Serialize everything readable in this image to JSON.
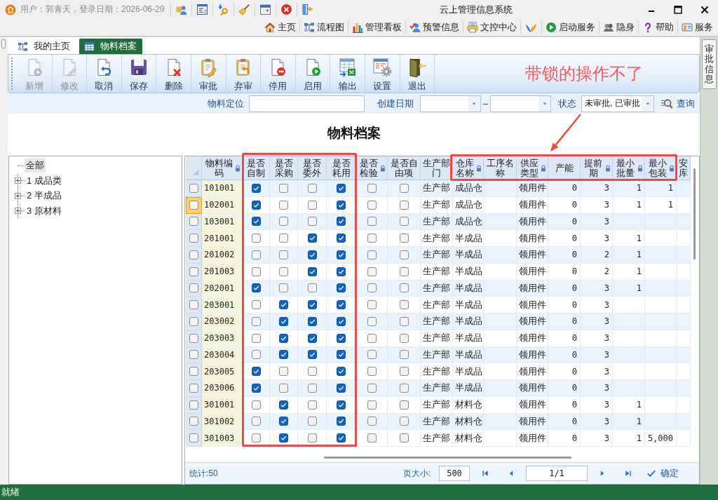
{
  "title_bar": {
    "user_info": "用户：郭青天，登录日期：2026-06-29",
    "title": "云上管理信息系统"
  },
  "quick_links": [
    {
      "label": "主页",
      "kind": "home"
    },
    {
      "label": "流程图",
      "kind": "flow"
    },
    {
      "label": "管理看板",
      "kind": "chart"
    },
    {
      "label": "预警信息",
      "kind": "alert"
    },
    {
      "label": "文控中心",
      "kind": "document"
    },
    {
      "kind": "logo"
    },
    {
      "label": "启动服务",
      "kind": "start"
    },
    {
      "label": "隐身",
      "kind": "hide"
    },
    {
      "label": "帮助",
      "kind": "help"
    },
    {
      "label": "服务",
      "kind": "service"
    }
  ],
  "tabs": [
    {
      "label": "我的主页",
      "kind": "home",
      "selected": false
    },
    {
      "label": "物料档案",
      "kind": "grid",
      "selected": true
    }
  ],
  "toolbar": [
    {
      "label": "新增",
      "kind": "new",
      "disabled": true
    },
    {
      "label": "修改",
      "kind": "edit",
      "disabled": true
    },
    {
      "label": "取消",
      "kind": "cancel",
      "disabled": false
    },
    {
      "label": "保存",
      "kind": "save",
      "disabled": false
    },
    {
      "label": "删除",
      "kind": "delete",
      "disabled": false
    },
    {
      "label": "审批",
      "kind": "approve",
      "disabled": false
    },
    {
      "label": "弃审",
      "kind": "unapprove",
      "disabled": false
    },
    {
      "label": "停用",
      "kind": "disable",
      "disabled": false
    },
    {
      "label": "启用",
      "kind": "enable",
      "disabled": false
    },
    {
      "label": "输出",
      "kind": "export",
      "disabled": false
    },
    {
      "label": "设置",
      "kind": "settings",
      "disabled": false
    },
    {
      "label": "退出",
      "kind": "exit",
      "disabled": false
    }
  ],
  "annotation": {
    "text": "带锁的操作不了"
  },
  "filters": {
    "material_label": "物料定位",
    "date_label": "创建日期",
    "date_separator": "–",
    "status_label": "状态",
    "status_value": "未审批, 已审批",
    "query": "查询"
  },
  "page_title": "物料档案",
  "tree": {
    "label": "全部",
    "selected": true,
    "children": [
      {
        "label": "1 成品类",
        "selected": false,
        "expanded": false
      },
      {
        "label": "2 半成品",
        "selected": false,
        "expanded": false
      },
      {
        "label": "3 原材料",
        "selected": false,
        "expanded": false
      }
    ]
  },
  "grid": {
    "columns": [
      {
        "label": "物料编码",
        "kind": "code",
        "locked": true,
        "marked": false,
        "marked_cells": false
      },
      {
        "label": "是否自制",
        "kind": "check",
        "locked": false,
        "marked": true,
        "marked_cells": true
      },
      {
        "label": "是否采购",
        "kind": "check",
        "locked": false,
        "marked": true,
        "marked_cells": true
      },
      {
        "label": "是否委外",
        "kind": "check",
        "locked": false,
        "marked": true,
        "marked_cells": true
      },
      {
        "label": "是否耗用",
        "kind": "check",
        "locked": false,
        "marked": true,
        "marked_cells": true
      },
      {
        "label": "是否检验",
        "kind": "check",
        "locked": true,
        "marked": false,
        "marked_cells": false
      },
      {
        "label": "是否自由项",
        "kind": "check",
        "locked": false,
        "marked": false,
        "marked_cells": false
      },
      {
        "label": "生产部门",
        "kind": "text",
        "locked": false,
        "marked": false,
        "marked_cells": false
      },
      {
        "label": "仓库名称",
        "kind": "text",
        "locked": true,
        "marked": true,
        "marked_cells": false
      },
      {
        "label": "工序名称",
        "kind": "text",
        "locked": false,
        "marked": true,
        "marked_cells": false
      },
      {
        "label": "供应类型",
        "kind": "text",
        "locked": true,
        "marked": true,
        "marked_cells": false
      },
      {
        "label": "产能",
        "kind": "number",
        "locked": false,
        "marked": true,
        "marked_cells": false
      },
      {
        "label": "提前期",
        "kind": "number",
        "locked": true,
        "marked": true,
        "marked_cells": false
      },
      {
        "label": "最小批量",
        "kind": "number",
        "locked": true,
        "marked": true,
        "marked_cells": false
      },
      {
        "label": "最小包装",
        "kind": "number",
        "locked": true,
        "marked": true,
        "marked_cells": false
      },
      {
        "label": "安库",
        "kind": "number",
        "locked": false,
        "marked": false,
        "marked_cells": false
      }
    ],
    "rows": [
      {
        "checked": false,
        "current": false,
        "code": "101001",
        "self_made": true,
        "purchased": false,
        "outsourced": false,
        "consumed": true,
        "inspected": false,
        "free_item": false,
        "department": "生产部",
        "warehouse": "成品仓",
        "supply_type": "领用件",
        "capacity": "0",
        "lead_time": "3",
        "min_batch": "1",
        "min_pack": "1"
      },
      {
        "checked": false,
        "current": true,
        "code": "102001",
        "self_made": true,
        "purchased": false,
        "outsourced": false,
        "consumed": true,
        "inspected": false,
        "free_item": false,
        "department": "生产部",
        "warehouse": "成品仓",
        "supply_type": "领用件",
        "capacity": "0",
        "lead_time": "3",
        "min_batch": "1",
        "min_pack": "1"
      },
      {
        "checked": false,
        "current": false,
        "code": "103001",
        "self_made": true,
        "purchased": false,
        "outsourced": false,
        "consumed": true,
        "inspected": false,
        "free_item": false,
        "department": "生产部",
        "warehouse": "成品仓",
        "supply_type": "领用件",
        "capacity": "0",
        "lead_time": "3"
      },
      {
        "checked": false,
        "current": false,
        "code": "201001",
        "self_made": false,
        "purchased": false,
        "outsourced": true,
        "consumed": true,
        "inspected": false,
        "free_item": false,
        "department": "生产部",
        "warehouse": "半成品",
        "supply_type": "领用件",
        "capacity": "0",
        "lead_time": "3",
        "min_batch": "1"
      },
      {
        "checked": false,
        "current": false,
        "code": "201002",
        "self_made": false,
        "purchased": false,
        "outsourced": true,
        "consumed": true,
        "inspected": false,
        "free_item": false,
        "department": "生产部",
        "warehouse": "半成品",
        "supply_type": "领用件",
        "capacity": "0",
        "lead_time": "2",
        "min_batch": "1"
      },
      {
        "checked": false,
        "current": false,
        "code": "201003",
        "self_made": false,
        "purchased": false,
        "outsourced": true,
        "consumed": true,
        "inspected": false,
        "free_item": false,
        "department": "生产部",
        "warehouse": "半成品",
        "supply_type": "领用件",
        "capacity": "0",
        "lead_time": "2",
        "min_batch": "1"
      },
      {
        "checked": false,
        "current": false,
        "code": "202001",
        "self_made": true,
        "purchased": false,
        "outsourced": false,
        "consumed": true,
        "inspected": false,
        "free_item": false,
        "department": "生产部",
        "warehouse": "半成品",
        "supply_type": "领用件",
        "capacity": "0",
        "lead_time": "3",
        "min_batch": "1"
      },
      {
        "checked": false,
        "current": false,
        "code": "203001",
        "self_made": false,
        "purchased": true,
        "outsourced": true,
        "consumed": true,
        "inspected": false,
        "free_item": false,
        "department": "生产部",
        "warehouse": "半成品",
        "supply_type": "领用件",
        "capacity": "0",
        "lead_time": "3"
      },
      {
        "checked": false,
        "current": false,
        "code": "203002",
        "self_made": false,
        "purchased": true,
        "outsourced": true,
        "consumed": true,
        "inspected": false,
        "free_item": false,
        "department": "生产部",
        "warehouse": "半成品",
        "supply_type": "领用件",
        "capacity": "0",
        "lead_time": "3"
      },
      {
        "checked": false,
        "current": false,
        "code": "203003",
        "self_made": false,
        "purchased": true,
        "outsourced": true,
        "consumed": true,
        "inspected": false,
        "free_item": false,
        "department": "生产部",
        "warehouse": "半成品",
        "supply_type": "领用件",
        "capacity": "0",
        "lead_time": "3"
      },
      {
        "checked": false,
        "current": false,
        "code": "203004",
        "self_made": false,
        "purchased": true,
        "outsourced": true,
        "consumed": true,
        "inspected": false,
        "free_item": false,
        "department": "生产部",
        "warehouse": "半成品",
        "supply_type": "领用件",
        "capacity": "0",
        "lead_time": "3"
      },
      {
        "checked": false,
        "current": false,
        "code": "203005",
        "self_made": true,
        "purchased": false,
        "outsourced": false,
        "consumed": true,
        "inspected": false,
        "free_item": false,
        "department": "生产部",
        "warehouse": "半成品",
        "supply_type": "领用件",
        "capacity": "0",
        "lead_time": "3"
      },
      {
        "checked": false,
        "current": false,
        "code": "203006",
        "self_made": true,
        "purchased": false,
        "outsourced": false,
        "consumed": true,
        "inspected": false,
        "free_item": false,
        "department": "生产部",
        "warehouse": "半成品",
        "supply_type": "领用件",
        "capacity": "0",
        "lead_time": "3"
      },
      {
        "checked": false,
        "current": false,
        "code": "301001",
        "self_made": false,
        "purchased": true,
        "outsourced": false,
        "consumed": true,
        "inspected": false,
        "free_item": false,
        "department": "生产部",
        "warehouse": "材料仓",
        "supply_type": "领用件",
        "capacity": "0",
        "lead_time": "3",
        "min_batch": "1"
      },
      {
        "checked": false,
        "current": false,
        "code": "301002",
        "self_made": false,
        "purchased": true,
        "outsourced": false,
        "consumed": true,
        "inspected": false,
        "free_item": false,
        "department": "生产部",
        "warehouse": "材料仓",
        "supply_type": "领用件",
        "capacity": "0",
        "lead_time": "3",
        "min_batch": "1"
      },
      {
        "checked": false,
        "current": false,
        "code": "301003",
        "self_made": false,
        "purchased": true,
        "outsourced": false,
        "consumed": true,
        "inspected": false,
        "free_item": false,
        "department": "生产部",
        "warehouse": "材料仓",
        "supply_type": "领用件",
        "capacity": "0",
        "lead_time": "3",
        "min_batch": "1",
        "min_pack": "5,000"
      }
    ],
    "footer": {
      "count": "统计:50",
      "page_size_label": "页大小:",
      "page_size": "500",
      "page": "1/1",
      "confirm": "确定"
    }
  },
  "side_panel": {
    "label": "审批信息"
  },
  "status_bar": "就绪"
}
